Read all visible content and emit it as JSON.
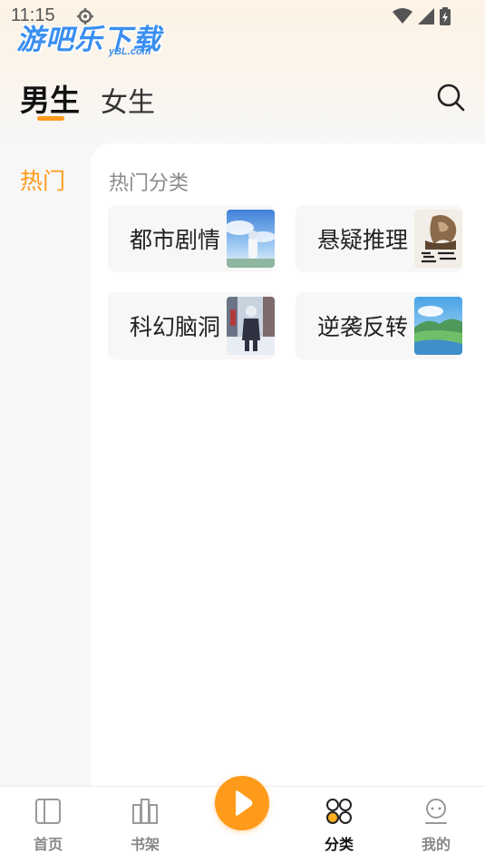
{
  "status_bar": {
    "time": "11:15",
    "icons": [
      "gear-icon",
      "wifi-icon",
      "signal-icon",
      "battery-icon"
    ]
  },
  "watermark": {
    "main": "游吧乐下载",
    "sub": "yBL.com"
  },
  "gender_tabs": [
    {
      "label": "男生",
      "active": true
    },
    {
      "label": "女生",
      "active": false
    }
  ],
  "rail": {
    "items": [
      {
        "label": "热门",
        "active": true
      }
    ]
  },
  "content": {
    "section_title": "热门分类",
    "categories": [
      {
        "label": "都市剧情",
        "thumb": "anime-sky-character"
      },
      {
        "label": "悬疑推理",
        "thumb": "book-cover-sketch"
      },
      {
        "label": "科幻脑洞",
        "thumb": "anime-street-character"
      },
      {
        "label": "逆袭反转",
        "thumb": "landscape-river"
      }
    ]
  },
  "bottom_nav": {
    "items": [
      {
        "label": "首页",
        "icon": "book-icon",
        "active": false
      },
      {
        "label": "书架",
        "icon": "bookshelf-icon",
        "active": false
      },
      {
        "label": "",
        "icon": "play-icon",
        "active": false
      },
      {
        "label": "分类",
        "icon": "category-icon",
        "active": true
      },
      {
        "label": "我的",
        "icon": "profile-icon",
        "active": false
      }
    ]
  },
  "colors": {
    "accent": "#ff9a1a",
    "background": "#f7f7f7",
    "card": "#f7f7f7",
    "watermark": "#3a8ff0"
  }
}
